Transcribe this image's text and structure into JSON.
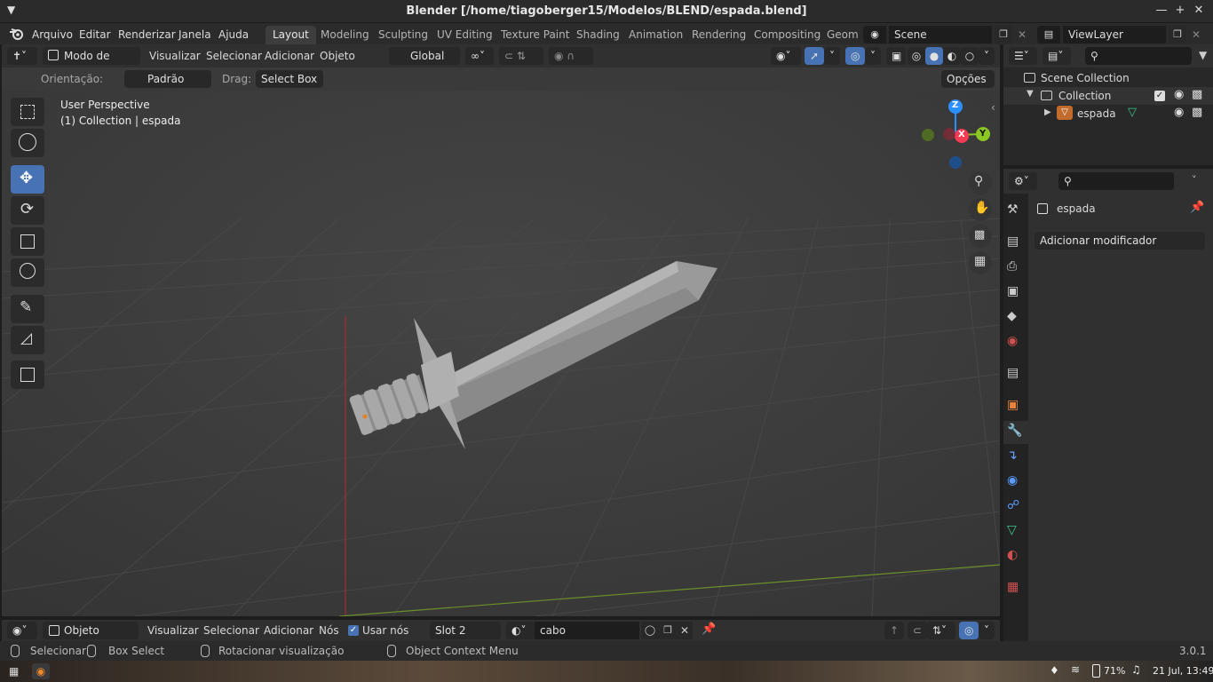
{
  "window": {
    "title": "Blender [/home/tiagoberger15/Modelos/BLEND/espada.blend]",
    "minimize": "—",
    "maximize": "+",
    "close": "✕"
  },
  "menubar": {
    "items": [
      "Arquivo",
      "Editar",
      "Renderizar",
      "Janela",
      "Ajuda"
    ],
    "workspaces": [
      "Layout",
      "Modeling",
      "Sculpting",
      "UV Editing",
      "Texture Paint",
      "Shading",
      "Animation",
      "Rendering",
      "Compositing",
      "Geom"
    ],
    "scene": "Scene",
    "view_layer": "ViewLayer"
  },
  "viewport_header": {
    "mode": "Modo de obj...",
    "menus": [
      "Visualizar",
      "Selecionar",
      "Adicionar",
      "Objeto"
    ],
    "transform_orientation": "Global"
  },
  "tool_settings": {
    "orientation_label": "Orientação:",
    "orientation_value": "Padrão",
    "drag_label": "Drag:",
    "drag_value": "Select Box",
    "options": "Opções"
  },
  "viewport": {
    "view_name": "User Perspective",
    "collection_info": "(1) Collection | espada",
    "gizmo": {
      "z": "Z",
      "x": "X",
      "y": "Y"
    }
  },
  "outliner": {
    "scene_collection": "Scene Collection",
    "collection": "Collection",
    "object": "espada"
  },
  "properties": {
    "object_name": "espada",
    "add_modifier": "Adicionar modificador"
  },
  "shader_header": {
    "mode": "Objeto",
    "menus": [
      "Visualizar",
      "Selecionar",
      "Adicionar",
      "Nós"
    ],
    "use_nodes": "Usar nós",
    "slot": "Slot 2",
    "material": "cabo"
  },
  "statusbar": {
    "select": "Selecionar",
    "box_select": "Box Select",
    "rotate_view": "Rotacionar visualização",
    "context_menu": "Object Context Menu",
    "version": "3.0.1"
  },
  "taskbar": {
    "battery": "71%",
    "clock": "21 Jul, 13:49"
  },
  "colors": {
    "accent": "#4772b3",
    "axis_x": "#f53a54",
    "axis_y": "#8ac624",
    "axis_z": "#2c8fff"
  }
}
